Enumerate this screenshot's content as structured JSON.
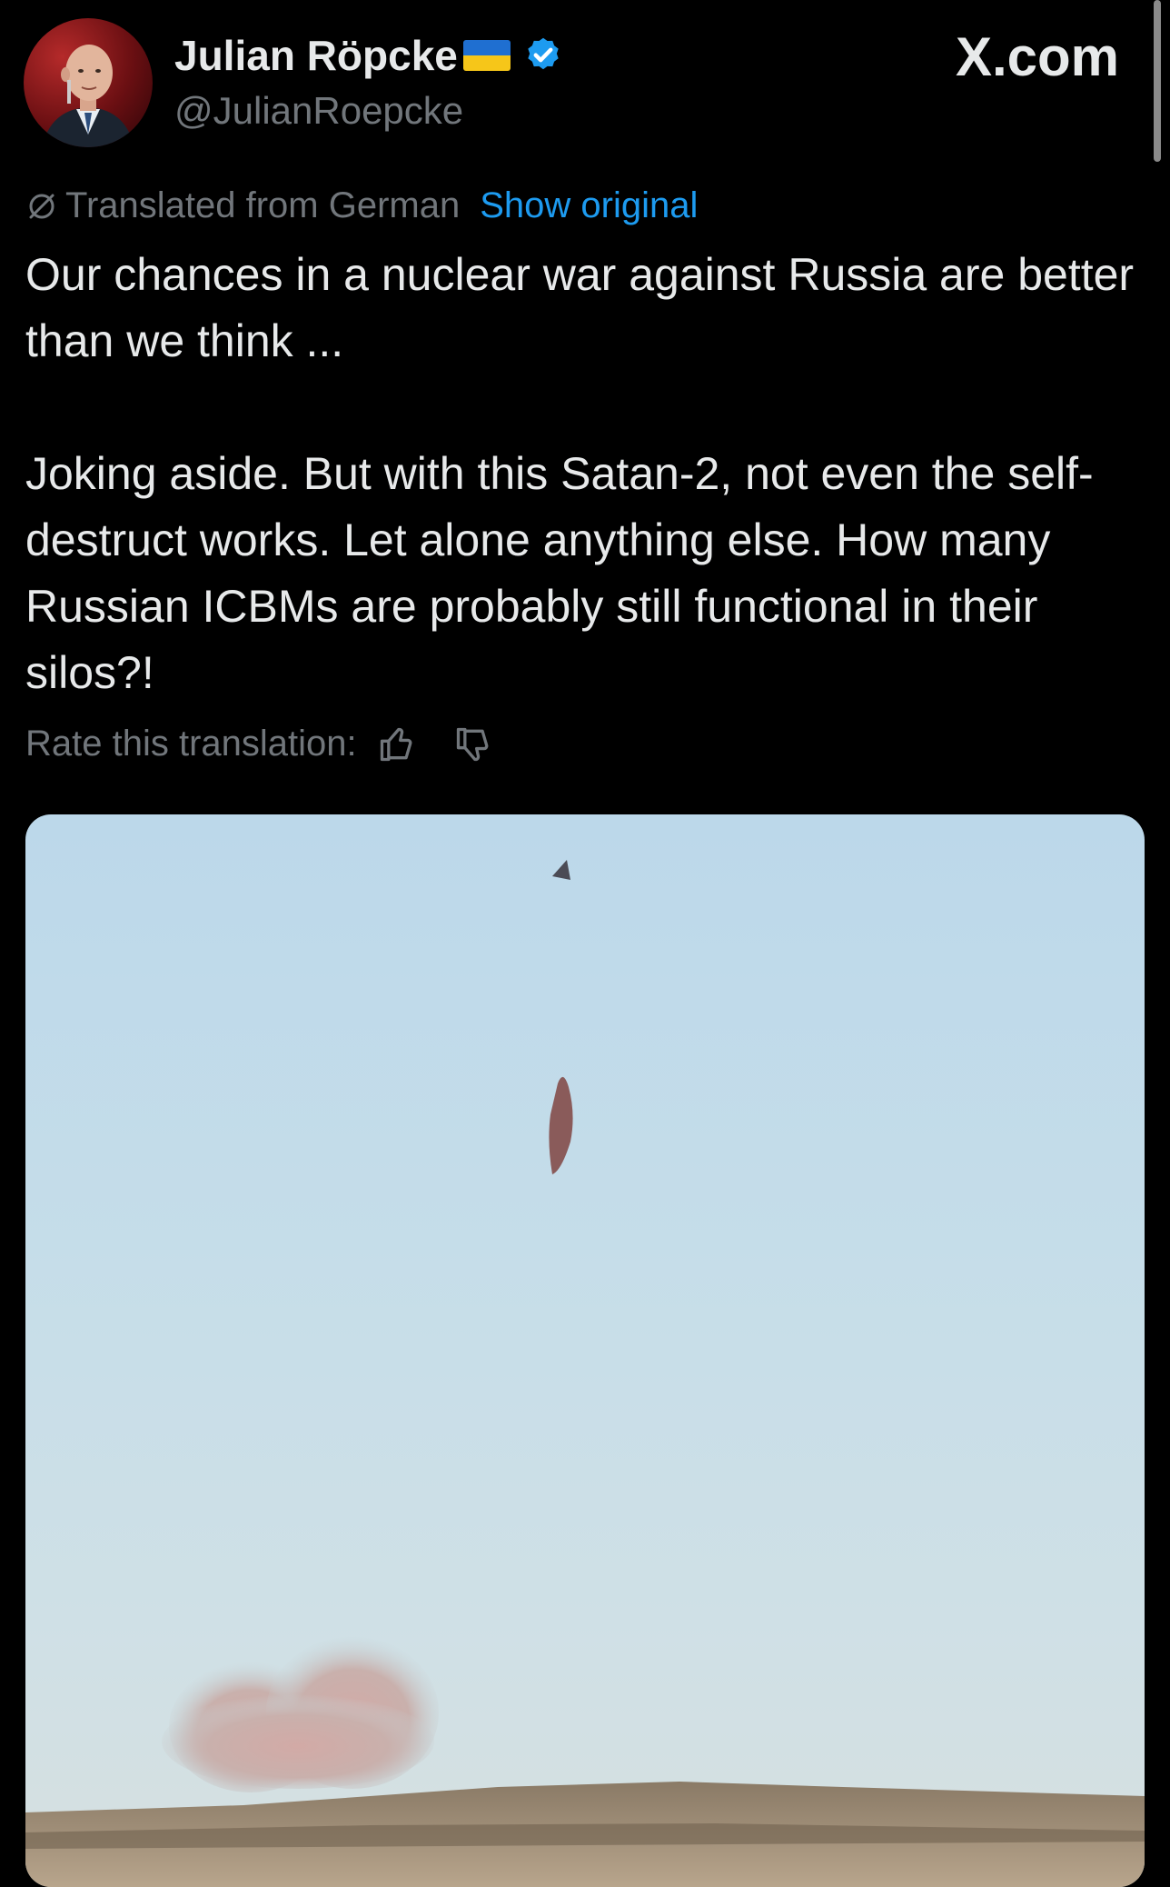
{
  "author": {
    "display_name": "Julian Röpcke",
    "handle": "@JulianRoepcke",
    "flag_colors": [
      "#1f6fd1",
      "#f6c619"
    ],
    "verified_color": "#1d9bf0"
  },
  "brand": "X.com",
  "translation": {
    "label": "Translated from German",
    "show_original": "Show original",
    "rate_label": "Rate this translation:"
  },
  "tweet": {
    "paragraphs": [
      "Our chances in a nuclear war against Russia are better than we think ...",
      "Joking aside. But with this Satan-2, not even the self-destruct works. Let alone anything else. How many Russian ICBMs are probably still functional in their silos?!"
    ]
  },
  "icons": {
    "translate": "globe-slash-icon",
    "like_translation": "thumbs-up-icon",
    "dislike_translation": "thumbs-down-icon",
    "verified": "verified-badge-icon"
  },
  "media": {
    "type": "video-still",
    "description_colors": {
      "sky": "#c5dde9",
      "smoke": "#c9a9a4",
      "ground": "#7a6a58"
    }
  },
  "colors": {
    "background": "#000000",
    "text_primary": "#e7e9ea",
    "text_secondary": "#71767b",
    "link": "#1d9bf0"
  }
}
